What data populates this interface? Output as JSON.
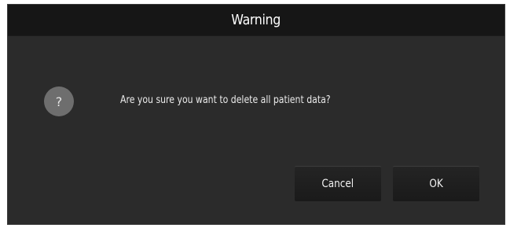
{
  "dialog": {
    "title": "Warning",
    "icon": "question-icon",
    "icon_glyph": "?",
    "message": "Are you sure you want to delete all patient data?",
    "buttons": {
      "cancel_label": "Cancel",
      "ok_label": "OK"
    }
  },
  "colors": {
    "background": "#2b2b2b",
    "titlebar": "#161616",
    "icon_bg": "#6e6e6e",
    "text": "#ececec"
  }
}
